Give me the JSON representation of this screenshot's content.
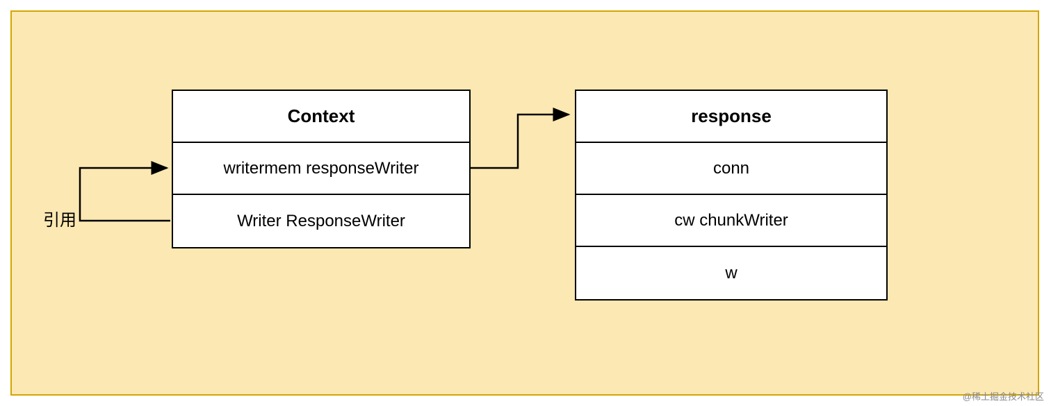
{
  "diagram": {
    "context": {
      "title": "Context",
      "fields": [
        "writermem responseWriter",
        "Writer ResponseWriter"
      ]
    },
    "response": {
      "title": "response",
      "fields": [
        "conn",
        "cw chunkWriter",
        "w"
      ]
    },
    "ref_label": "引用",
    "watermark": "@稀土掘金技术社区"
  }
}
